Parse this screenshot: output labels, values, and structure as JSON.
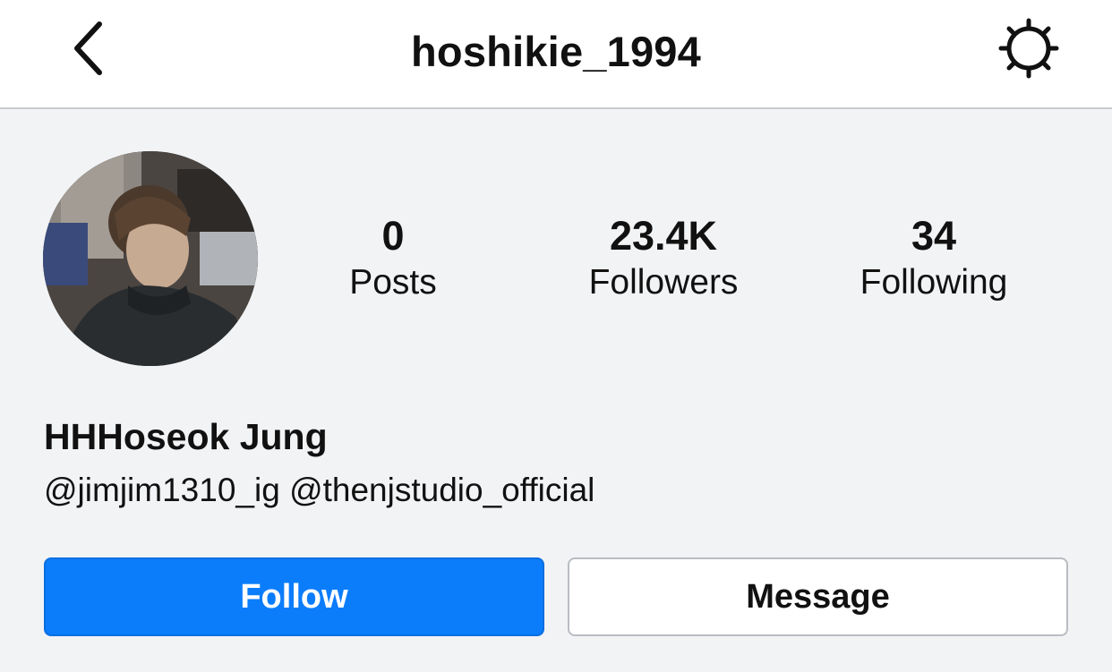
{
  "header": {
    "username": "hoshikie_1994",
    "back_icon": "chevron-left-icon",
    "settings_icon": "gear-icon"
  },
  "profile": {
    "avatar": "profile-photo",
    "display_name": "HHHoseok Jung",
    "bio_mentions": [
      "@jimjim1310_ig",
      "@thenjstudio_official"
    ]
  },
  "stats": {
    "posts": {
      "value": "0",
      "label": "Posts"
    },
    "followers": {
      "value": "23.4K",
      "label": "Followers"
    },
    "following": {
      "value": "34",
      "label": "Following"
    }
  },
  "actions": {
    "follow_label": "Follow",
    "message_label": "Message"
  },
  "colors": {
    "accent": "#0b7dfb",
    "background": "#f2f3f5",
    "header_bg": "#ffffff"
  }
}
